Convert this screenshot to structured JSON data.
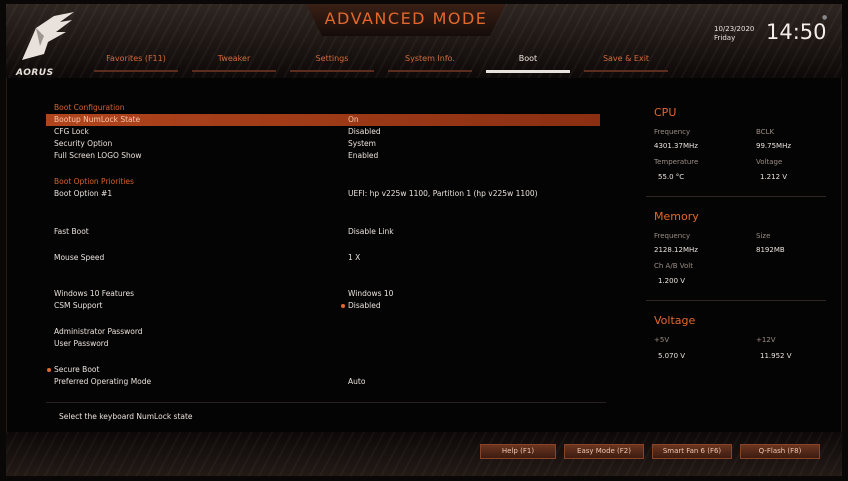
{
  "header": {
    "brand": "AORUS",
    "mode_title": "ADVANCED MODE",
    "date": "10/23/2020",
    "day": "Friday",
    "time": "14:50",
    "tabs": [
      {
        "label": "Favorites (F11)",
        "active": false
      },
      {
        "label": "Tweaker",
        "active": false
      },
      {
        "label": "Settings",
        "active": false
      },
      {
        "label": "System Info.",
        "active": false
      },
      {
        "label": "Boot",
        "active": true
      },
      {
        "label": "Save & Exit",
        "active": false
      }
    ]
  },
  "boot": {
    "section_config": "Boot Configuration",
    "numlock": {
      "label": "Bootup NumLock State",
      "value": "On"
    },
    "cfg_lock": {
      "label": "CFG Lock",
      "value": "Disabled"
    },
    "security_option": {
      "label": "Security Option",
      "value": "System"
    },
    "fullscreen_logo": {
      "label": "Full Screen LOGO Show",
      "value": "Enabled"
    },
    "section_priorities": "Boot Option Priorities",
    "boot_option_1": {
      "label": "Boot Option #1",
      "value": "UEFI: hp v225w 1100, Partition 1 (hp v225w 1100)"
    },
    "fast_boot": {
      "label": "Fast Boot",
      "value": "Disable Link"
    },
    "mouse_speed": {
      "label": "Mouse Speed",
      "value": "1 X"
    },
    "win10_features": {
      "label": "Windows 10 Features",
      "value": "Windows 10"
    },
    "csm_support": {
      "label": "CSM Support",
      "value": "Disabled"
    },
    "admin_password": {
      "label": "Administrator Password"
    },
    "user_password": {
      "label": "User Password"
    },
    "secure_boot": {
      "label": "Secure Boot"
    },
    "preferred_os": {
      "label": "Preferred Operating Mode",
      "value": "Auto"
    }
  },
  "help_text": "Select the keyboard NumLock state",
  "sidebar": {
    "cpu": {
      "title": "CPU",
      "freq_label": "Frequency",
      "freq_value": "4301.37MHz",
      "bclk_label": "BCLK",
      "bclk_value": "99.75MHz",
      "temp_label": "Temperature",
      "temp_value": "55.0 °C",
      "volt_label": "Voltage",
      "volt_value": "1.212 V"
    },
    "memory": {
      "title": "Memory",
      "freq_label": "Frequency",
      "freq_value": "2128.12MHz",
      "size_label": "Size",
      "size_value": "8192MB",
      "chab_label": "Ch A/B Volt",
      "chab_value": "1.200 V"
    },
    "voltage": {
      "title": "Voltage",
      "v5_label": "+5V",
      "v5_value": "5.070 V",
      "v12_label": "+12V",
      "v12_value": "11.952 V"
    }
  },
  "footer": {
    "help": "Help (F1)",
    "easy_mode": "Easy Mode (F2)",
    "smart_fan": "Smart Fan 6 (F6)",
    "qflash": "Q-Flash (F8)"
  },
  "colors": {
    "accent": "#e3682c",
    "selected_row": "#b0451d",
    "background": "#050404"
  }
}
